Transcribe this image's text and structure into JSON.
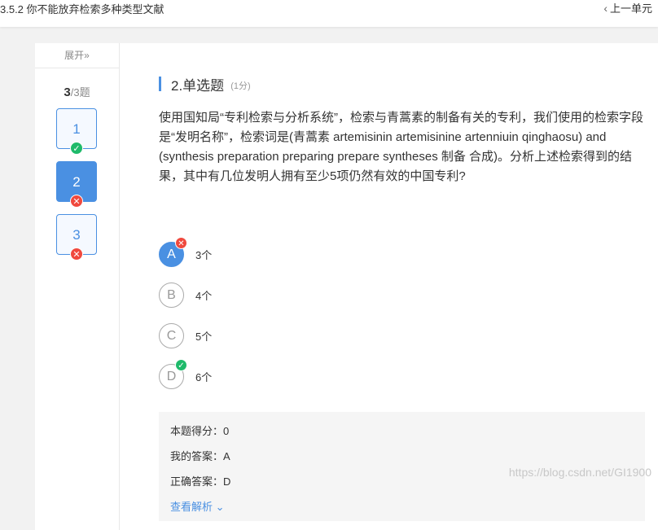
{
  "topbar": {
    "title": "3.5.2 你不能放弃检索多种类型文献",
    "prev_label": "上一单元"
  },
  "sidebar": {
    "expand_label": "展开»",
    "counter_current": "3",
    "counter_suffix": "/3题",
    "questions": [
      {
        "label": "1",
        "status": "correct",
        "active": false
      },
      {
        "label": "2",
        "status": "wrong",
        "active": true
      },
      {
        "label": "3",
        "status": "wrong",
        "active": false
      }
    ]
  },
  "question": {
    "title": "2.单选题",
    "points": "(1分)",
    "stem": "使用国知局“专利检索与分析系统”，检索与青蒿素的制备有关的专利，我们使用的检索字段是“发明名称”，检索词是(青蒿素 artemisinin artemisinine artenniuin qinghaosu) and (synthesis preparation preparing prepare syntheses 制备 合成)。分析上述检索得到的结果，其中有几位发明人拥有至少5项仍然有效的中国专利?",
    "options": [
      {
        "letter": "A",
        "text": "3个",
        "selected": true,
        "mark": "wrong"
      },
      {
        "letter": "B",
        "text": "4个",
        "selected": false,
        "mark": ""
      },
      {
        "letter": "C",
        "text": "5个",
        "selected": false,
        "mark": ""
      },
      {
        "letter": "D",
        "text": "6个",
        "selected": false,
        "mark": "correct"
      }
    ]
  },
  "result": {
    "score": "本题得分：0",
    "my_answer": "我的答案：A",
    "correct_answer": "正确答案：D",
    "analysis_link": "查看解析"
  },
  "watermark": "https://blog.csdn.net/GI1900",
  "icons": {
    "check": "✓",
    "cross": "✕",
    "chevron_left": "‹",
    "chevron_down": "⌄"
  },
  "colors": {
    "accent": "#4a90e2",
    "correct": "#1fba6b",
    "wrong": "#f0493e"
  }
}
